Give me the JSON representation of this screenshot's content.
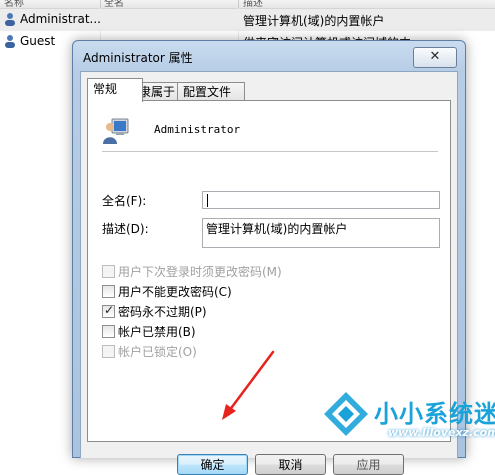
{
  "background_list": {
    "headers": [
      "名称",
      "全名",
      "描述"
    ],
    "rows": [
      {
        "name": "Administrat...",
        "description": "管理计算机(域)的内置帐户",
        "selected": true
      },
      {
        "name": "Guest",
        "description": "供来宾访问计算机或访问域的内",
        "selected": false
      }
    ]
  },
  "dialog": {
    "title": "Administrator 属性",
    "close_glyph": "✕",
    "tabs": [
      {
        "label": "常规",
        "active": true
      },
      {
        "label": "隶属于",
        "active": false
      },
      {
        "label": "配置文件",
        "active": false
      }
    ],
    "user_name": "Administrator",
    "fields": {
      "full_name_label": "全名(F):",
      "full_name_value": "",
      "description_label": "描述(D):",
      "description_value": "管理计算机(域)的内置帐户"
    },
    "checkboxes": [
      {
        "label": "用户下次登录时须更改密码(M)",
        "checked": false,
        "enabled": false
      },
      {
        "label": "用户不能更改密码(C)",
        "checked": false,
        "enabled": true
      },
      {
        "label": "密码永不过期(P)",
        "checked": true,
        "enabled": true
      },
      {
        "label": "帐户已禁用(B)",
        "checked": false,
        "enabled": true
      },
      {
        "label": "帐户已锁定(O)",
        "checked": false,
        "enabled": false
      }
    ],
    "buttons": {
      "ok": "确定",
      "cancel": "取消",
      "apply": "应用"
    }
  },
  "watermark": {
    "title": "小小系统迷",
    "url": "www.lilovexz.com"
  },
  "colors": {
    "arrow": "#e8231e",
    "watermark": "#1aa3d9"
  }
}
